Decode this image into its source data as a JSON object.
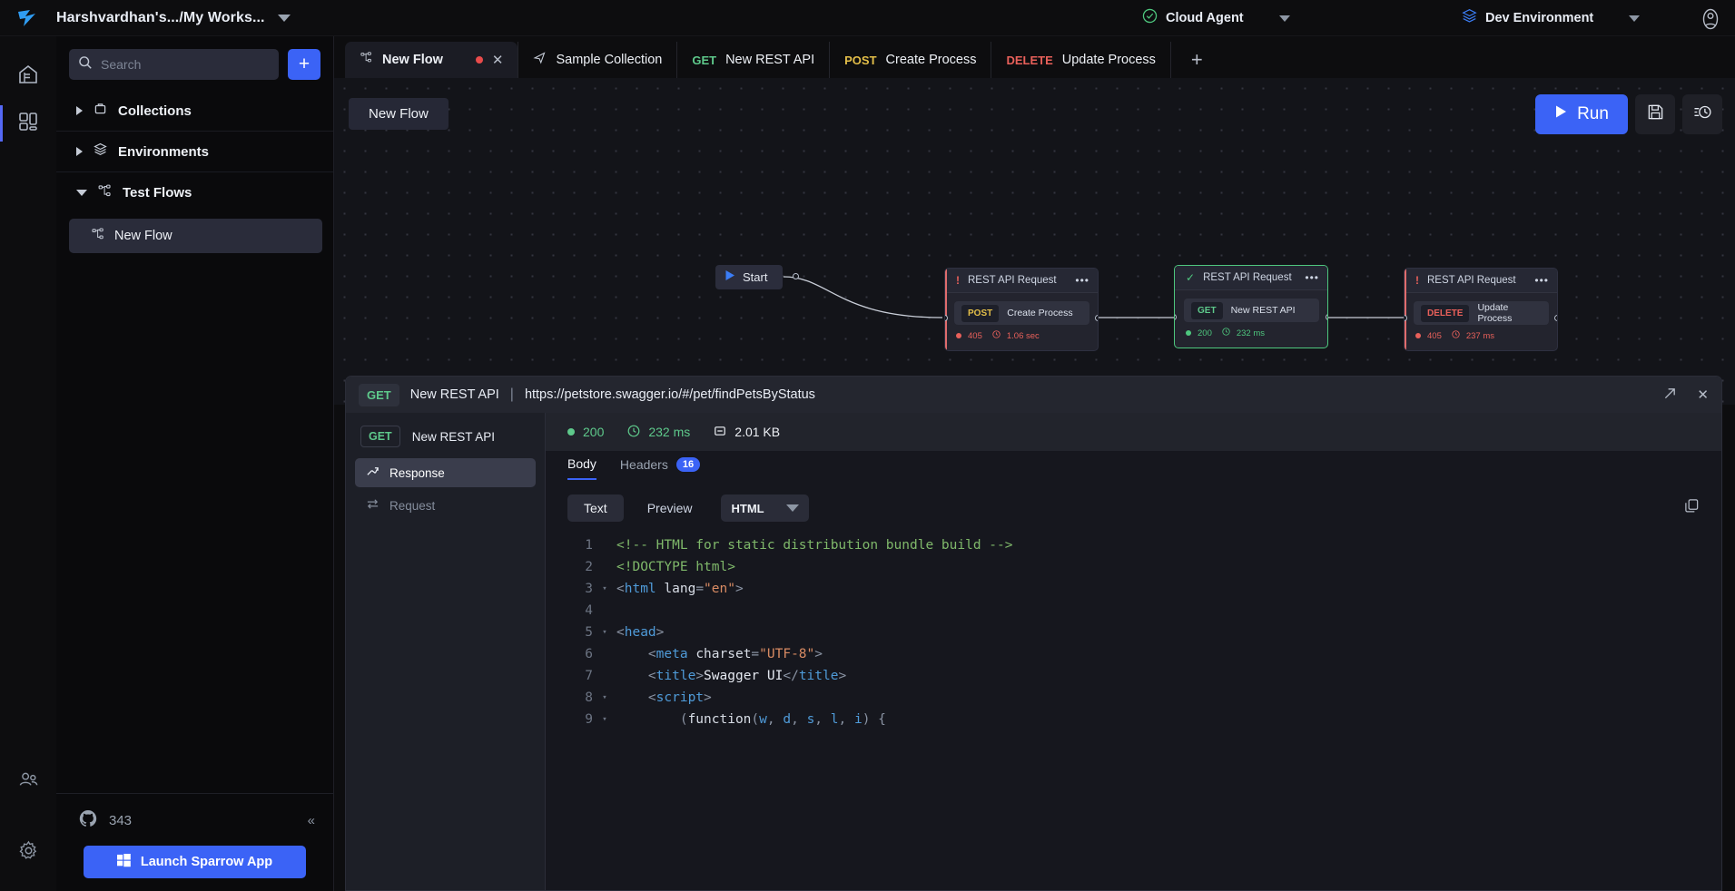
{
  "topbar": {
    "logo": "sparrow-logo-icon",
    "workspace": "Harshvardhan's.../My Works...",
    "agent": {
      "label": "Cloud Agent",
      "icon": "check-circle-icon"
    },
    "environment": {
      "label": "Dev Environment",
      "icon": "layers-icon"
    },
    "avatar": "user-avatar-icon"
  },
  "rail": {
    "items": [
      {
        "name": "home",
        "icon": "home-icon",
        "active": false
      },
      {
        "name": "workspaces",
        "icon": "grid-icon",
        "active": true
      }
    ],
    "bottom": [
      {
        "name": "community",
        "icon": "people-icon"
      },
      {
        "name": "settings",
        "icon": "gear-icon"
      }
    ]
  },
  "sidebar": {
    "search": {
      "placeholder": "Search",
      "value": "",
      "icon": "search-icon"
    },
    "add_label": "+",
    "tree": [
      {
        "label": "Collections",
        "icon": "collections-icon",
        "expanded": false
      },
      {
        "label": "Environments",
        "icon": "layers-icon",
        "expanded": false
      },
      {
        "label": "Test Flows",
        "icon": "flow-icon",
        "expanded": true
      }
    ],
    "child": {
      "label": "New Flow",
      "icon": "flow-icon"
    },
    "footer": {
      "github_icon": "github-icon",
      "stars": "343",
      "collapse_icon": "chevron-double-left-icon",
      "launch_label": "Launch Sparrow App",
      "launch_icon": "windows-icon"
    }
  },
  "tabstrip": {
    "tabs": [
      {
        "name": "New Flow",
        "method": "",
        "method_color": "",
        "icon": "flow-icon",
        "active": true,
        "unsaved": true
      },
      {
        "name": "Sample Collection",
        "method": "",
        "method_color": "",
        "icon": "send-icon",
        "active": false,
        "unsaved": false
      },
      {
        "name": "New REST API",
        "method": "GET",
        "method_color": "#5ec98b",
        "icon": "",
        "active": false,
        "unsaved": false
      },
      {
        "name": "Create Process",
        "method": "POST",
        "method_color": "#e4bf49",
        "icon": "",
        "active": false,
        "unsaved": false
      },
      {
        "name": "Update Process",
        "method": "DELETE",
        "method_color": "#e8605a",
        "icon": "",
        "active": false,
        "unsaved": false
      }
    ],
    "add_tab": "+"
  },
  "canvas": {
    "flow_chip": "New Flow",
    "run_label": "Run",
    "run_icon": "play-icon",
    "save_icon": "save-icon",
    "history_icon": "history-icon",
    "start_node": {
      "label": "Start",
      "icon": "play-icon"
    },
    "nodes": [
      {
        "title": "REST API Request",
        "status_icon": "warning-exclamation-icon",
        "status_color": "#e8605a",
        "accent": "#e06c6c",
        "selected": false,
        "method": "POST",
        "method_color": "#e4bf49",
        "request_name": "Create Process",
        "code": "405",
        "time": "1.06 sec",
        "meta_color": "#e8605a"
      },
      {
        "title": "REST API Request",
        "status_icon": "check-icon",
        "status_color": "#4ec77e",
        "accent": "#4ec77e",
        "selected": true,
        "method": "GET",
        "method_color": "#5ec98b",
        "request_name": "New REST API",
        "code": "200",
        "time": "232 ms",
        "meta_color": "#4ec77e"
      },
      {
        "title": "REST API Request",
        "status_icon": "warning-exclamation-icon",
        "status_color": "#e8605a",
        "accent": "#e06c6c",
        "selected": false,
        "method": "DELETE",
        "method_color": "#e8605a",
        "request_name": "Update Process",
        "code": "405",
        "time": "237 ms",
        "meta_color": "#e8605a"
      }
    ]
  },
  "response_panel": {
    "header": {
      "method": "GET",
      "name": "New REST API",
      "separator": "|",
      "url": "https://petstore.swagger.io/#/pet/findPetsByStatus",
      "expand_icon": "expand-arrow-icon",
      "close_icon": "close-icon"
    },
    "side": {
      "method": "GET",
      "name": "New REST API",
      "items": [
        {
          "label": "Response",
          "icon": "response-icon",
          "active": true
        },
        {
          "label": "Request",
          "icon": "request-icon",
          "active": false
        }
      ]
    },
    "stats": {
      "status": "200",
      "time": "232 ms",
      "size": "2.01 KB",
      "status_icon": "status-dot-icon",
      "time_icon": "clock-icon",
      "size_icon": "size-icon"
    },
    "tabs": [
      {
        "label": "Body",
        "active": true,
        "badge": ""
      },
      {
        "label": "Headers",
        "active": false,
        "badge": "16"
      }
    ],
    "controls": {
      "text_label": "Text",
      "preview_label": "Preview",
      "format": "HTML",
      "copy_icon": "copy-icon"
    },
    "code_lines": [
      {
        "n": "1",
        "fold": false,
        "tokens": [
          {
            "t": "<!-- HTML for static distribution bundle build -->",
            "c": "c-com"
          }
        ]
      },
      {
        "n": "2",
        "fold": false,
        "tokens": [
          {
            "t": "<!DOCTYPE html>",
            "c": "c-com"
          }
        ]
      },
      {
        "n": "3",
        "fold": true,
        "tokens": [
          {
            "t": "<",
            "c": "c-brk"
          },
          {
            "t": "html",
            "c": "c-tag"
          },
          {
            "t": " ",
            "c": "c-txt"
          },
          {
            "t": "lang",
            "c": "c-attr"
          },
          {
            "t": "=",
            "c": "c-brk"
          },
          {
            "t": "\"en\"",
            "c": "c-str"
          },
          {
            "t": ">",
            "c": "c-brk"
          }
        ]
      },
      {
        "n": "4",
        "fold": false,
        "tokens": [
          {
            "t": "",
            "c": "c-txt"
          }
        ]
      },
      {
        "n": "5",
        "fold": true,
        "tokens": [
          {
            "t": "<",
            "c": "c-brk"
          },
          {
            "t": "head",
            "c": "c-tag"
          },
          {
            "t": ">",
            "c": "c-brk"
          }
        ]
      },
      {
        "n": "6",
        "fold": false,
        "tokens": [
          {
            "t": "    <",
            "c": "c-brk"
          },
          {
            "t": "meta",
            "c": "c-tag"
          },
          {
            "t": " ",
            "c": "c-txt"
          },
          {
            "t": "charset",
            "c": "c-attr"
          },
          {
            "t": "=",
            "c": "c-brk"
          },
          {
            "t": "\"UTF-8\"",
            "c": "c-str"
          },
          {
            "t": ">",
            "c": "c-brk"
          }
        ]
      },
      {
        "n": "7",
        "fold": false,
        "tokens": [
          {
            "t": "    <",
            "c": "c-brk"
          },
          {
            "t": "title",
            "c": "c-tag"
          },
          {
            "t": ">",
            "c": "c-brk"
          },
          {
            "t": "Swagger UI",
            "c": "c-txt"
          },
          {
            "t": "</",
            "c": "c-brk"
          },
          {
            "t": "title",
            "c": "c-tag"
          },
          {
            "t": ">",
            "c": "c-brk"
          }
        ]
      },
      {
        "n": "8",
        "fold": true,
        "tokens": [
          {
            "t": "    <",
            "c": "c-brk"
          },
          {
            "t": "script",
            "c": "c-tag"
          },
          {
            "t": ">",
            "c": "c-brk"
          }
        ]
      },
      {
        "n": "9",
        "fold": true,
        "tokens": [
          {
            "t": "        (",
            "c": "c-brk"
          },
          {
            "t": "function",
            "c": "c-fn"
          },
          {
            "t": "(",
            "c": "c-brk"
          },
          {
            "t": "w",
            "c": "c-var"
          },
          {
            "t": ", ",
            "c": "c-brk"
          },
          {
            "t": "d",
            "c": "c-var"
          },
          {
            "t": ", ",
            "c": "c-brk"
          },
          {
            "t": "s",
            "c": "c-var"
          },
          {
            "t": ", ",
            "c": "c-brk"
          },
          {
            "t": "l",
            "c": "c-var"
          },
          {
            "t": ", ",
            "c": "c-brk"
          },
          {
            "t": "i",
            "c": "c-var"
          },
          {
            "t": ") {",
            "c": "c-brk"
          }
        ]
      }
    ]
  }
}
